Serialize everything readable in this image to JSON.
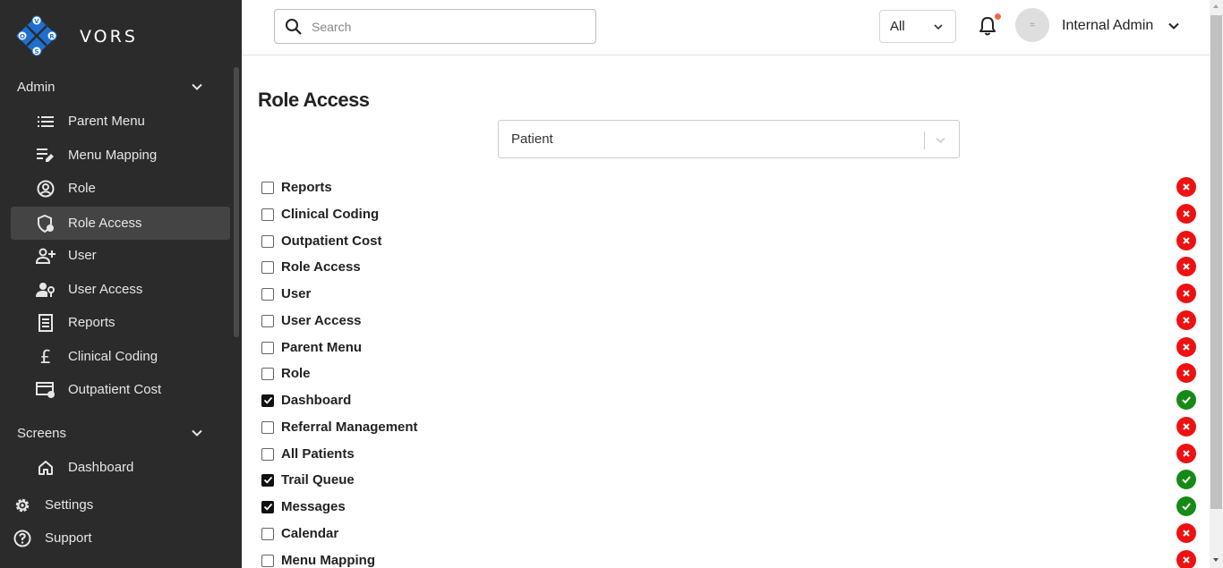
{
  "brand": {
    "name": "VORS",
    "logo_letters": [
      "V",
      "O",
      "R",
      "S"
    ]
  },
  "sidebar": {
    "sections": [
      {
        "label": "Admin"
      },
      {
        "label": "Screens"
      }
    ],
    "admin_items": [
      {
        "label": "Parent Menu",
        "icon": "list-icon"
      },
      {
        "label": "Menu Mapping",
        "icon": "edit-list-icon"
      },
      {
        "label": "Role",
        "icon": "account-circle-icon"
      },
      {
        "label": "Role Access",
        "icon": "shield-lock-icon",
        "active": true
      },
      {
        "label": "User",
        "icon": "person-add-icon"
      },
      {
        "label": "User Access",
        "icon": "person-key-icon"
      },
      {
        "label": "Reports",
        "icon": "report-icon"
      },
      {
        "label": "Clinical Coding",
        "icon": "pound-icon"
      },
      {
        "label": "Outpatient Cost",
        "icon": "card-cost-icon"
      }
    ],
    "screen_items": [
      {
        "label": "Dashboard",
        "icon": "home-icon"
      }
    ],
    "root_items": [
      {
        "label": "Settings",
        "icon": "gear-icon"
      },
      {
        "label": "Support",
        "icon": "help-circle-icon"
      }
    ]
  },
  "header": {
    "search_placeholder": "Search",
    "filter_value": "All",
    "avatar_text": "=",
    "user_name": "Internal Admin"
  },
  "main": {
    "title": "Role Access",
    "role_select_value": "Patient",
    "permissions": [
      {
        "label": "Reports",
        "checked": false
      },
      {
        "label": "Clinical Coding",
        "checked": false
      },
      {
        "label": "Outpatient Cost",
        "checked": false
      },
      {
        "label": "Role Access",
        "checked": false
      },
      {
        "label": "User",
        "checked": false
      },
      {
        "label": "User Access",
        "checked": false
      },
      {
        "label": "Parent Menu",
        "checked": false
      },
      {
        "label": "Role",
        "checked": false
      },
      {
        "label": "Dashboard",
        "checked": true
      },
      {
        "label": "Referral Management",
        "checked": false
      },
      {
        "label": "All Patients",
        "checked": false
      },
      {
        "label": "Trail Queue",
        "checked": true
      },
      {
        "label": "Messages",
        "checked": true
      },
      {
        "label": "Calendar",
        "checked": false
      },
      {
        "label": "Menu Mapping",
        "checked": false
      }
    ]
  },
  "colors": {
    "sidebar_bg": "#2b2b2b",
    "active_item_bg": "#444444",
    "granted": "#168a16",
    "denied": "#ee1111",
    "notification_dot": "#f06a4a",
    "logo_blue": "#1e6fd0"
  }
}
